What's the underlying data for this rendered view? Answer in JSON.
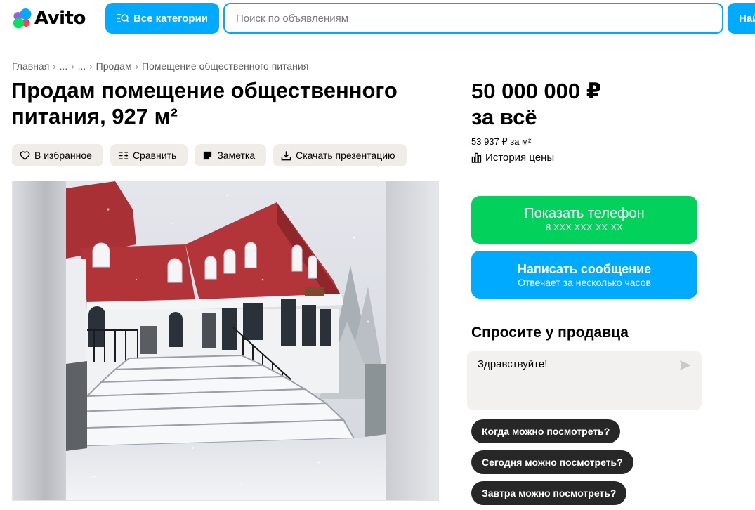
{
  "header": {
    "logo_text": "Avito",
    "categories_label": "Все категории",
    "search_placeholder": "Поиск по объявлениям",
    "find_label": "Найти",
    "accent_color": "#00aaff"
  },
  "breadcrumbs": [
    "Главная",
    "...",
    "...",
    "Продам",
    "Помещение общественного питания"
  ],
  "listing": {
    "title": "Продам помещение общественного питания, 927 м²",
    "actions": [
      {
        "label": "В избранное",
        "icon": "heart-icon"
      },
      {
        "label": "Сравнить",
        "icon": "compare-icon"
      },
      {
        "label": "Заметка",
        "icon": "note-icon"
      },
      {
        "label": "Скачать презентацию",
        "icon": "download-icon"
      }
    ]
  },
  "price": {
    "amount": "50 000 000 ₽",
    "suffix": "за всё",
    "per_m2": "53 937 ₽ за м²",
    "history_label": "История цены"
  },
  "contact": {
    "phone_label": "Показать телефон",
    "phone_masked": "8 XXX XXX-XX-XX",
    "phone_color": "#02d15c",
    "message_label": "Написать сообщение",
    "message_sub": "Отвечает за несколько часов"
  },
  "ask_seller": {
    "title": "Спросите у продавца",
    "message_value": "Здравствуйте!",
    "quick_questions": [
      "Когда можно посмотреть?",
      "Сегодня можно посмотреть?",
      "Завтра можно посмотреть?"
    ]
  }
}
